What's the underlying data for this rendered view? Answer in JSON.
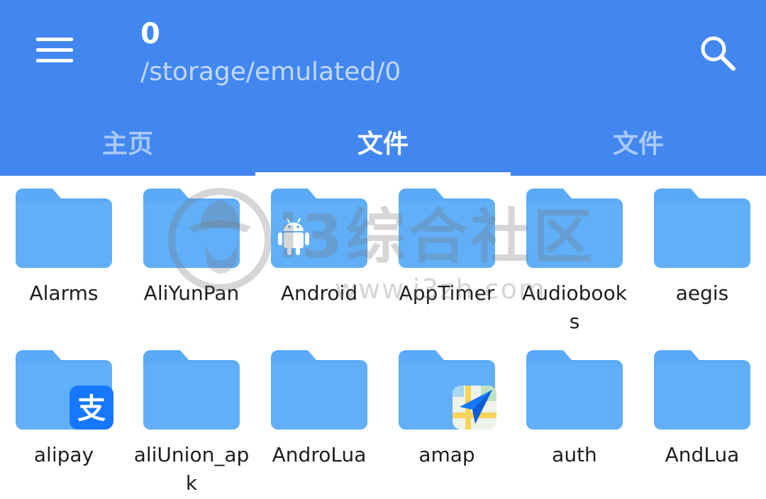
{
  "header": {
    "title": "0",
    "subtitle": "/storage/emulated/0",
    "menu_icon": "hamburger-menu-icon",
    "search_icon": "search-icon",
    "color": "#4287f0"
  },
  "tabs": [
    {
      "label": "主页",
      "active": false
    },
    {
      "label": "文件",
      "active": true
    },
    {
      "label": "文件",
      "active": false
    }
  ],
  "folders": [
    {
      "name": "Alarms",
      "badge": ""
    },
    {
      "name": "AliYunPan",
      "badge": ""
    },
    {
      "name": "Android",
      "badge": "android-icon"
    },
    {
      "name": "AppTimer",
      "badge": ""
    },
    {
      "name": "Audiobook\ns",
      "badge": ""
    },
    {
      "name": "aegis",
      "badge": ""
    },
    {
      "name": "alipay",
      "badge": "alipay-icon"
    },
    {
      "name": "aliUnion_ap\nk",
      "badge": ""
    },
    {
      "name": "AndroLua",
      "badge": ""
    },
    {
      "name": "amap",
      "badge": "amap-icon"
    },
    {
      "name": "auth",
      "badge": ""
    },
    {
      "name": "AndLua",
      "badge": ""
    }
  ],
  "folder_color": "#5baaf8",
  "watermark": {
    "text": "i3综合社区",
    "url": "www.i3zh.com"
  }
}
